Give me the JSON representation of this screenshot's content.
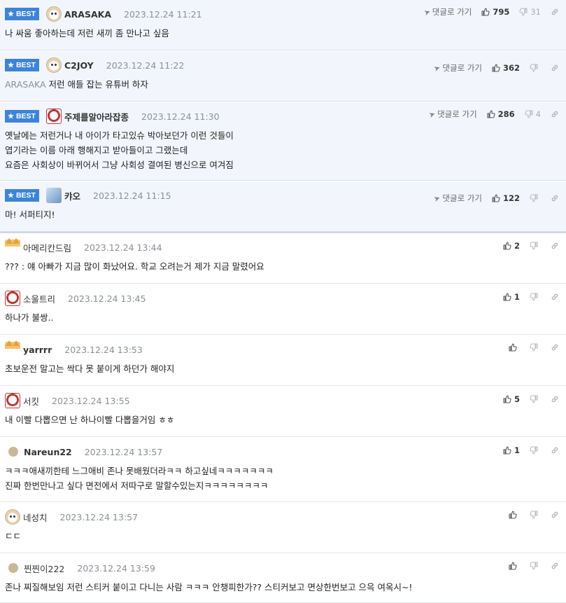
{
  "labels": {
    "best": "BEST",
    "reply": "댓글로 가기"
  },
  "colors": {
    "best_bg": "#f2f6fc",
    "badge": "#3d84d6",
    "date": "#8a8f96"
  },
  "best_comments": [
    {
      "nick": "ARASAKA",
      "avatar": "dog",
      "date": "2023.12.24 11:21",
      "likes": "795",
      "dislikes": "31",
      "quote": "",
      "lines": [
        "나 싸움 좋아하는데 저런 새끼 좀 만나고 싶음"
      ]
    },
    {
      "nick": "C2JOY",
      "avatar": "dog",
      "date": "2023.12.24 11:22",
      "likes": "362",
      "dislikes": "",
      "quote": "ARASAKA",
      "lines": [
        "저런 애들 잡는 유튜버 하자"
      ]
    },
    {
      "nick": "주제를알아라잡종",
      "avatar": "red",
      "date": "2023.12.24 11:30",
      "likes": "286",
      "dislikes": "4",
      "quote": "",
      "lines": [
        "옛날에는 저런거나 내 아이가 타고있슈 박아보던가 이런 것들이",
        "엽기라는 이름 아래 행해지고 받아들이고 그랬는데",
        "요즘은 사회상이 바뀌어서 그냥 사회성 결여된 병신으로 여겨짐"
      ]
    },
    {
      "nick": "캬오",
      "avatar": "blue",
      "date": "2023.12.24 11:15",
      "likes": "122",
      "dislikes": "",
      "quote": "",
      "lines": [
        "마! 서퍼티지!"
      ]
    }
  ],
  "comments": [
    {
      "nick": "아메리칸드림",
      "avatar": "fox",
      "date": "2023.12.24 13:44",
      "likes": "2",
      "lines": [
        "??? : 얘 아빠가 지금 많이 화났어요. 학교 오려는거 제가 지금 말렸어요"
      ]
    },
    {
      "nick": "소울트리",
      "avatar": "red",
      "date": "2023.12.24 13:45",
      "likes": "1",
      "lines": [
        "하나가 불쌍.."
      ]
    },
    {
      "nick": "yarrrr",
      "avatar": "fox",
      "date": "2023.12.24 13:53",
      "likes": "",
      "lines": [
        "초보운전 말고는 싹다 못 붙이게 하던가 해야지"
      ]
    },
    {
      "nick": "서킷",
      "avatar": "red",
      "date": "2023.12.24 13:55",
      "likes": "5",
      "lines": [
        "내 이빨 다뽑으면 난 하나이빨 다뽑을거임 ㅎㅎ"
      ]
    },
    {
      "nick": "Nareun22",
      "avatar": "tan",
      "date": "2023.12.24 13:57",
      "likes": "1",
      "lines": [
        "ㅋㅋㅋ애새끼한테 느그애비 존나 못배웠더라ㅋㅋ 하고싶네ㅋㅋㅋㅋㅋㅋㅋ",
        "진짜 한번만나고 싶다 면전에서 저따구로 말할수있는지ㅋㅋㅋㅋㅋㅋㅋㅋ"
      ]
    },
    {
      "nick": "네성치",
      "avatar": "dog",
      "date": "2023.12.24 13:57",
      "likes": "",
      "lines": [
        "ㄷㄷ"
      ]
    },
    {
      "nick": "찐찐이222",
      "avatar": "tan",
      "date": "2023.12.24 13:59",
      "likes": "",
      "lines": [
        "존나 찌질해보임 저런 스티커 붙이고 다니는 사람 ㅋㅋㅋ 안챙피한가?? 스티커보고 면상한번보고 으윽 여옥시~!"
      ]
    }
  ]
}
